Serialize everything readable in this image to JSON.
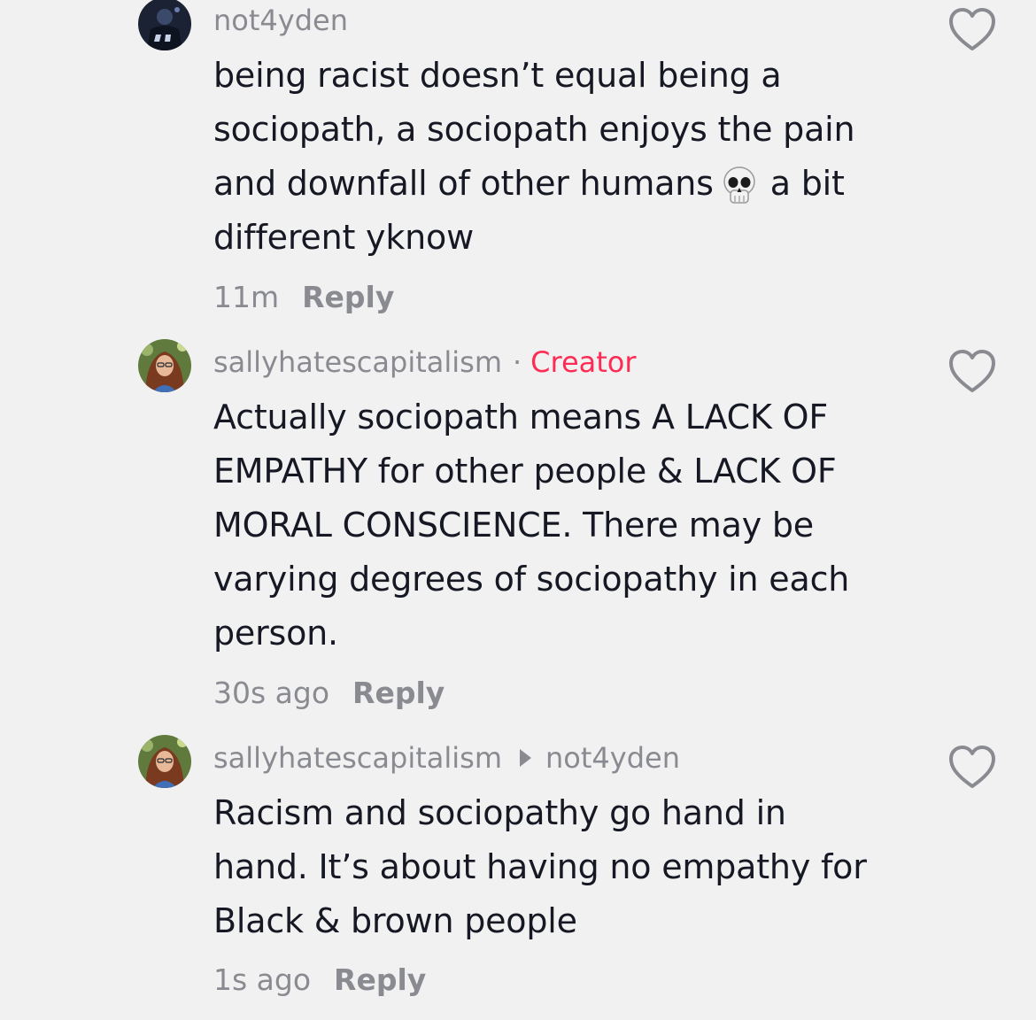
{
  "comments": [
    {
      "username": "not4yden",
      "text_lines": [
        "being racist doesn’t equal being a",
        "sociopath, a sociopath enjoys the pain",
        "and downfall of other humans",
        "a bit",
        "different yknow"
      ],
      "emoji": "skull",
      "time": "11m",
      "reply_label": "Reply"
    },
    {
      "username": "sallyhatescapitalism",
      "separator": "·",
      "badge": "Creator",
      "text_lines": [
        "Actually sociopath means A LACK OF",
        "EMPATHY for other people & LACK OF",
        "MORAL CONSCIENCE. There may be",
        "varying degrees of sociopathy in each",
        "person."
      ],
      "time": "30s ago",
      "reply_label": "Reply"
    },
    {
      "username": "sallyhatescapitalism",
      "reply_to": "not4yden",
      "text_lines": [
        "Racism and sociopathy go hand in",
        "hand. It’s about having no empathy for",
        "Black & brown people"
      ],
      "time": "1s ago",
      "reply_label": "Reply"
    }
  ],
  "colors": {
    "background": "#f1f1f2",
    "text": "#161823",
    "muted": "#8a8b91",
    "creator_badge": "#fe2c55"
  },
  "icons": {
    "like": "heart-outline-icon",
    "reply_arrow": "triangle-right-icon",
    "emoji": "skull-emoji-icon"
  }
}
